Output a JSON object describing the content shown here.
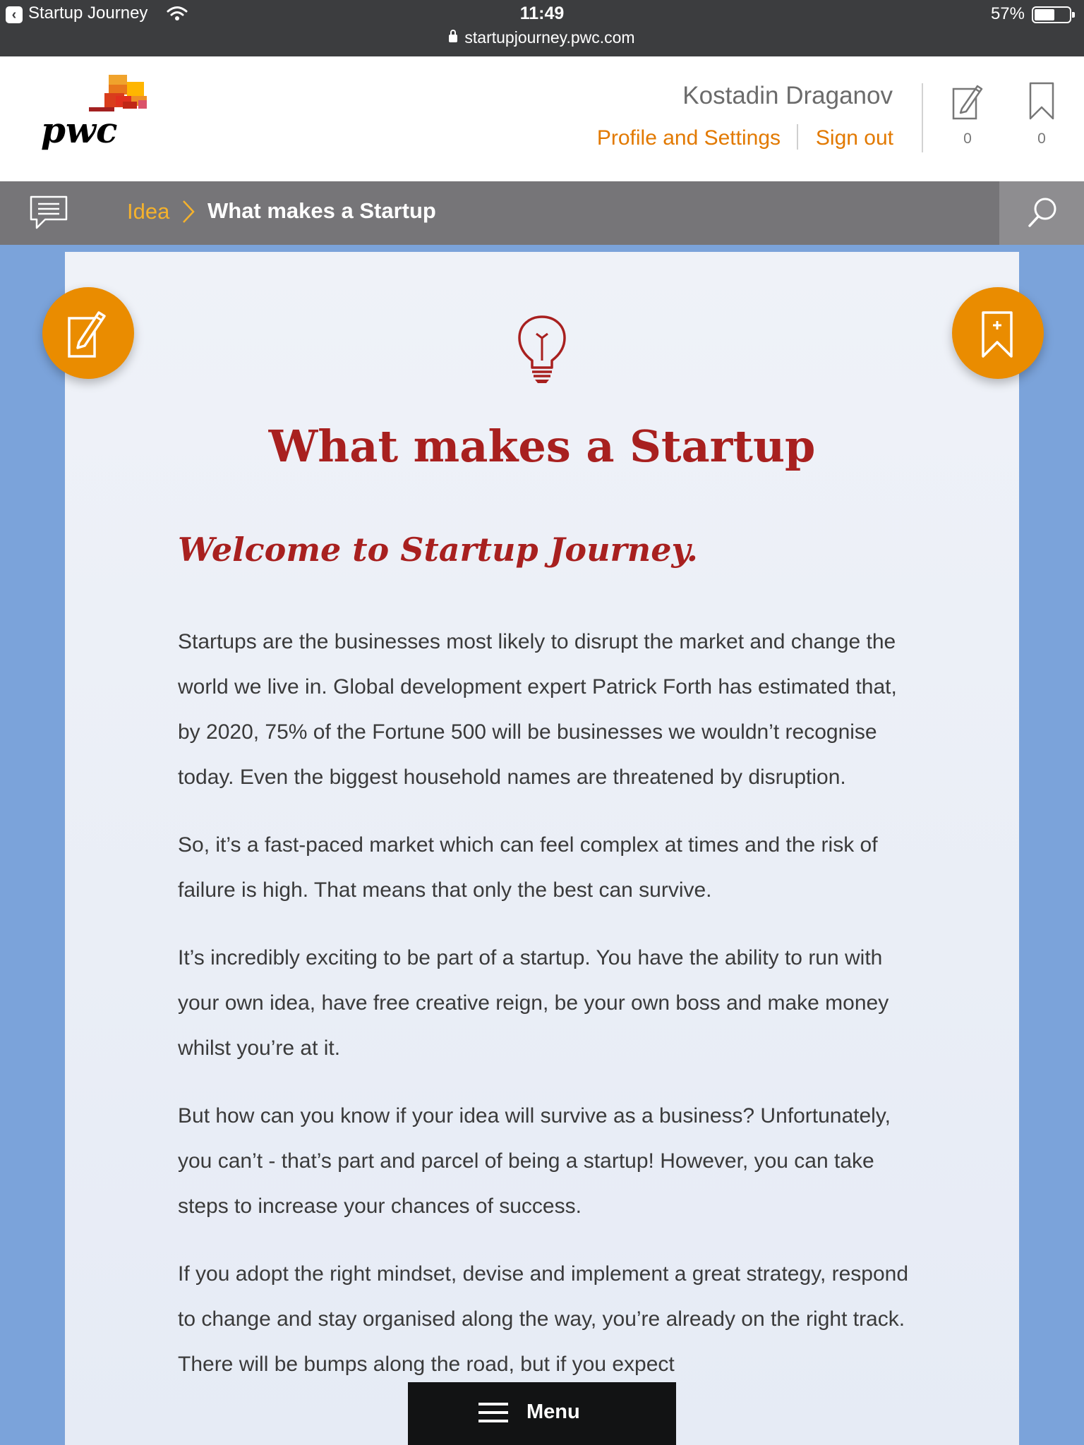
{
  "status_bar": {
    "back_app": "Startup Journey",
    "time": "11:49",
    "battery": "57%",
    "url": "startupjourney.pwc.com"
  },
  "header": {
    "logo_text": "pwc",
    "user_name": "Kostadin Draganov",
    "profile_link": "Profile and Settings",
    "signout_link": "Sign out",
    "notes_count": "0",
    "bookmarks_count": "0"
  },
  "breadcrumb": {
    "parent": "Idea",
    "current": "What makes a Startup"
  },
  "article": {
    "title": "What makes a Startup",
    "subtitle": "Welcome to Startup Journey.",
    "paragraphs": [
      "Startups are the businesses most likely to disrupt the market and change the world we live in. Global development expert Patrick Forth has estimated that, by 2020, 75% of the Fortune 500 will be businesses we wouldn’t recognise today. Even the biggest household names are threatened by disruption.",
      "So, it’s a fast-paced market which can feel complex at times and the risk of failure is high. That means that only the best can survive.",
      "It’s incredibly exciting to be part of a startup. You have the ability to run with your own idea, have free creative reign, be your own boss and make money whilst you’re at it.",
      "But how can you know if your idea will survive as a business? Unfortunately, you can’t - that’s part and parcel of being a startup! However, you can take steps to increase your chances of success.",
      "If you adopt the right mindset, devise and implement a great strategy, respond to change and stay organised along the way, you’re already on the right track. There will be bumps along the road, but if you expect"
    ]
  },
  "menu": {
    "label": "Menu"
  },
  "icons": {
    "note": "note-edit-icon",
    "bookmark": "bookmark-icon",
    "chat": "chat-icon",
    "search": "search-icon",
    "bulb": "lightbulb-icon"
  },
  "colors": {
    "accent_orange": "#ea8c00",
    "link_orange": "#e27900",
    "crumb_yellow": "#f5b22c",
    "title_red": "#a8201f",
    "bar_gray": "#767578"
  }
}
